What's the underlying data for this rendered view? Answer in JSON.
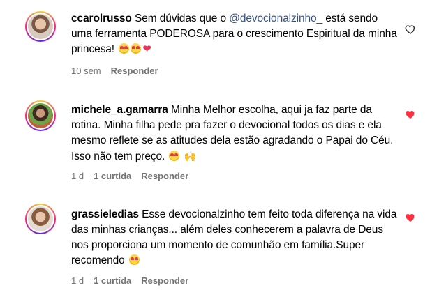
{
  "comments": [
    {
      "username": "ccarolrusso",
      "text_before": "Sem dúvidas que o ",
      "mention": "@devocionalzinho_",
      "text_after": " está sendo uma ferramenta PODEROSA para o crescimento Espiritual da minha princesa!",
      "emojis": [
        "smiling-face-with-heart-eyes",
        "smiling-face-with-heart-eyes",
        "pink-heart"
      ],
      "time": "10 sem",
      "likes": "",
      "reply_label": "Responder",
      "liked": false
    },
    {
      "username": "michele_a.gamarra",
      "text": "Minha Melhor escolha, aqui ja faz parte da rotina. Minha filha pede pra fazer o devocional todos os dias e ela mesmo reflete se as atitudes dela estão agradando o Papai do Céu. Isso não tem preço.",
      "emojis": [
        "smiling-face-with-heart-eyes",
        "raising-hands"
      ],
      "time": "1 d",
      "likes": "1 curtida",
      "reply_label": "Responder",
      "liked": true
    },
    {
      "username": "grassieledias",
      "text": "Esse devocionalzinho tem feito toda diferença na vida das minhas crianças... além deles conhecerem a palavra de Deus nos proporciona um momento de comunhão em família.Super recomendo",
      "emojis": [
        "smiling-face-with-heart-eyes"
      ],
      "time": "1 d",
      "likes": "1 curtida",
      "reply_label": "Responder",
      "liked": true
    }
  ],
  "colors": {
    "mention": "#385185",
    "meta_text": "#737373",
    "like_red": "#ff3040"
  },
  "icons": {
    "unliked": "heart-outline-icon",
    "liked": "heart-filled-icon"
  }
}
